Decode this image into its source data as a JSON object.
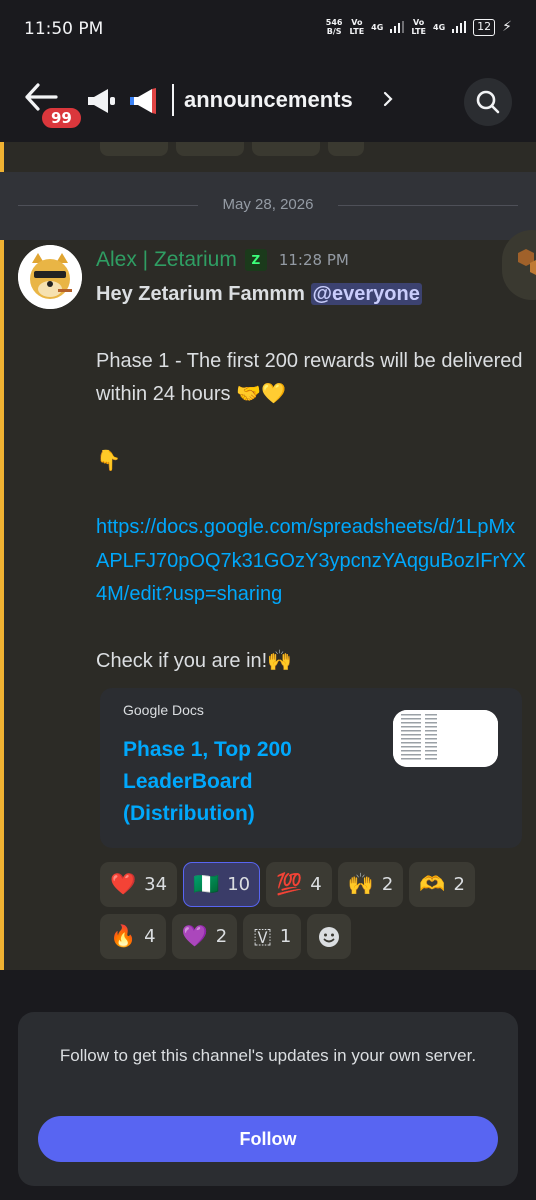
{
  "status_bar": {
    "time": "11:50 PM",
    "net_speed": "546",
    "net_unit": "B/S",
    "sim1_a": "Vo",
    "sim1_b": "LTE",
    "sim1_gen": "4G",
    "sim2_a": "Vo",
    "sim2_b": "LTE",
    "sim2_gen": "4G",
    "battery": "12"
  },
  "header": {
    "unread_badge": "99",
    "channel_name": "announcements",
    "icons": [
      "back-arrow-icon",
      "megaphone-icon",
      "megaphone-color-icon",
      "chevron-right-icon",
      "search-icon"
    ]
  },
  "divider": {
    "date": "May 28, 2026"
  },
  "message": {
    "author": "Alex | Zetarium",
    "role_tag": "Z",
    "timestamp": "11:28 PM",
    "greeting": "Hey Zetarium Fammm ",
    "mention": "@everyone",
    "line1": "Phase 1 - The first 200 rewards will be delivered within 24 hours ",
    "line1_emoji": "🤝💛",
    "pointer_emoji": "👇",
    "link": "https://docs.google.com/spreadsheets/d/1LpMxAPLFJ70pOQ7k31GOzY3ypcnzYAqguBozIFrYX4M/edit?usp=sharing",
    "check_line": "Check if you are in!",
    "check_emoji": "🙌"
  },
  "embed": {
    "provider": "Google Docs",
    "title": "Phase 1, Top 200 LeaderBoard (Distribution)"
  },
  "reactions": [
    {
      "emoji": "❤️",
      "count": "34",
      "active": false
    },
    {
      "emoji": "🇳🇬",
      "count": "10",
      "active": true
    },
    {
      "emoji": "💯",
      "count": "4",
      "active": false
    },
    {
      "emoji": "🙌",
      "count": "2",
      "active": false
    },
    {
      "emoji": "🫶",
      "count": "2",
      "active": false
    },
    {
      "emoji": "🔥",
      "count": "4",
      "active": false
    },
    {
      "emoji": "💜",
      "count": "2",
      "active": false
    },
    {
      "emoji": "🇻",
      "count": "1",
      "active": false
    }
  ],
  "follow": {
    "text": "Follow to get this channel's updates in your own server.",
    "button": "Follow"
  },
  "colors": {
    "accent": "#5865f2",
    "author": "#2f9e63",
    "link": "#00a8fc",
    "highlight_bar": "#f0b232",
    "badge": "#da373c"
  }
}
